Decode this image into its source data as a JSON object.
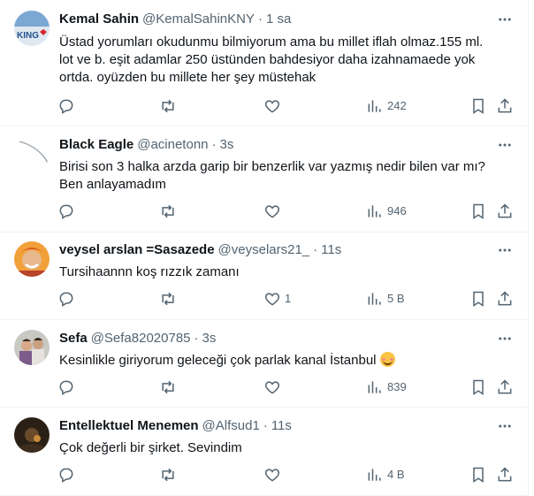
{
  "tweets": [
    {
      "name": "Kemal Sahin",
      "handle": "@KemalSahinKNY",
      "dot": "·",
      "time": "1 sa",
      "lines": [
        "Üstad yorumları okudunmu bilmiyorum ama bu millet iflah olmaz.155 ml.",
        "lot ve b. eşit adamlar 250 üstünden bahdesiyor daha izahnamaede yok",
        "ortda. oyüzden bu millete her şey müstehak"
      ],
      "reply_count": "",
      "retweet_count": "",
      "like_count": "",
      "views": "242"
    },
    {
      "name": "Black Eagle",
      "handle": "@acinetonn",
      "dot": "·",
      "time": "3s",
      "lines": [
        "Birisi son 3 halka arzda garip bir benzerlik var yazmış nedir bilen var mı?",
        "Ben anlayamadım"
      ],
      "reply_count": "",
      "retweet_count": "",
      "like_count": "",
      "views": "946"
    },
    {
      "name": "veysel arslan =Sasazede",
      "handle": "@veyselars21_",
      "dot": "·",
      "time": "11s",
      "lines": [
        "Tursihaannn koş rızzık zamanı"
      ],
      "reply_count": "",
      "retweet_count": "",
      "like_count": "1",
      "views": "5 B"
    },
    {
      "name": "Sefa",
      "handle": "@Sefa82020785",
      "dot": "·",
      "time": "3s",
      "lines": [
        "Kesinlikle giriyorum geleceği çok parlak kanal İstanbul"
      ],
      "emoji": "smiling-face-emoji",
      "reply_count": "",
      "retweet_count": "",
      "like_count": "",
      "views": "839"
    },
    {
      "name": "Entellektuel Menemen",
      "handle": "@Alfsud1",
      "dot": "·",
      "time": "11s",
      "lines": [
        "Çok değerli bir şirket. Sevindim"
      ],
      "reply_count": "",
      "retweet_count": "",
      "like_count": "",
      "views": "4 B"
    }
  ],
  "icons": {
    "reply": "reply-icon",
    "retweet": "retweet-icon",
    "like": "like-icon",
    "views": "views-icon",
    "bookmark": "bookmark-icon",
    "share": "share-icon",
    "more": "more-icon"
  },
  "colors": {
    "text": "#0f1419",
    "secondary": "#536471",
    "divider": "#eff3f4"
  }
}
